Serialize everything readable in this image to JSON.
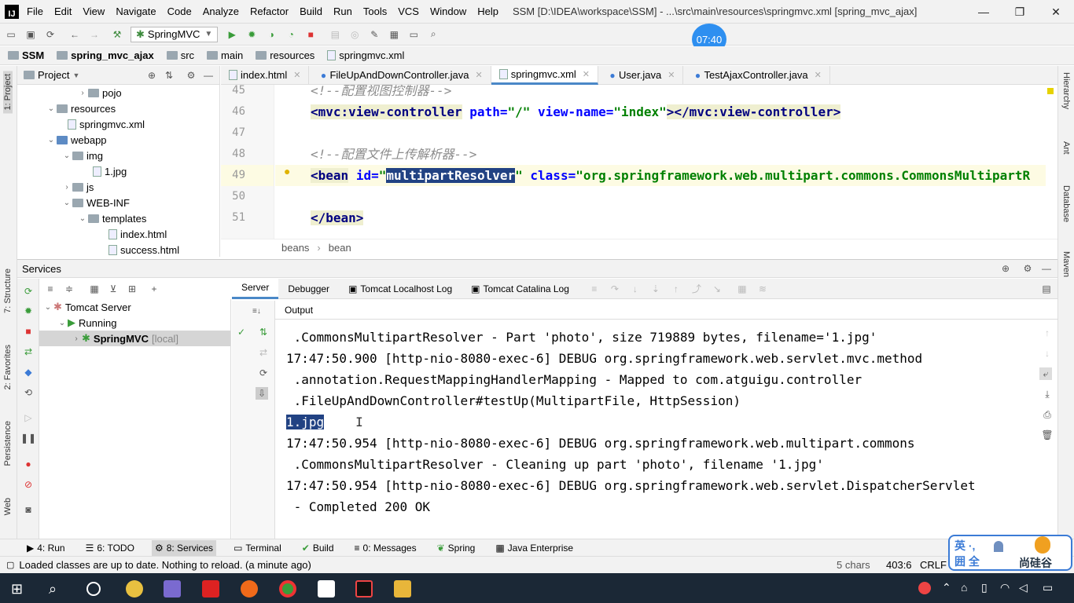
{
  "window": {
    "title": "SSM [D:\\IDEA\\workspace\\SSM] - ...\\src\\main\\resources\\springmvc.xml [spring_mvc_ajax]",
    "menu": [
      "File",
      "Edit",
      "View",
      "Navigate",
      "Code",
      "Analyze",
      "Refactor",
      "Build",
      "Run",
      "Tools",
      "VCS",
      "Window",
      "Help"
    ],
    "controls": {
      "min": "—",
      "max": "❐",
      "close": "✕"
    }
  },
  "toolbar": {
    "run_config": "SpringMVC",
    "clock": "07:40"
  },
  "breadcrumb": [
    "SSM",
    "spring_mvc_ajax",
    "src",
    "main",
    "resources",
    "springmvc.xml"
  ],
  "left_stripe": [
    "1: Project",
    "7: Structure",
    "2: Favorites",
    "Persistence",
    "Web"
  ],
  "right_stripe": [
    "Hierarchy",
    "Ant",
    "Database",
    "Maven"
  ],
  "project": {
    "header": "Project",
    "tree": [
      {
        "label": "pojo",
        "depth": 4,
        "arrow": "›",
        "kind": "folder"
      },
      {
        "label": "resources",
        "depth": 2,
        "arrow": "⌄",
        "kind": "folder"
      },
      {
        "label": "springmvc.xml",
        "depth": 3,
        "arrow": "",
        "kind": "file"
      },
      {
        "label": "webapp",
        "depth": 2,
        "arrow": "⌄",
        "kind": "folder"
      },
      {
        "label": "img",
        "depth": 3,
        "arrow": "⌄",
        "kind": "folder"
      },
      {
        "label": "1.jpg",
        "depth": 4,
        "arrow": "",
        "kind": "file"
      },
      {
        "label": "js",
        "depth": 3,
        "arrow": "›",
        "kind": "folder"
      },
      {
        "label": "WEB-INF",
        "depth": 3,
        "arrow": "⌄",
        "kind": "folder"
      },
      {
        "label": "templates",
        "depth": 4,
        "arrow": "⌄",
        "kind": "folder"
      },
      {
        "label": "index.html",
        "depth": 5,
        "arrow": "",
        "kind": "file"
      },
      {
        "label": "success.html",
        "depth": 5,
        "arrow": "",
        "kind": "file"
      }
    ]
  },
  "editor": {
    "tabs": [
      "index.html",
      "FileUpAndDownController.java",
      "springmvc.xml",
      "User.java",
      "TestAjaxController.java"
    ],
    "active_tab": 2,
    "line_numbers": [
      "45",
      "46",
      "47",
      "48",
      "49",
      "50",
      "51"
    ],
    "lines": {
      "l45": "<!--配置视图控制器-->",
      "l46_tag_open": "<mvc:view-controller",
      "l46_a1": "path=",
      "l46_v1": "\"/\"",
      "l46_a2": "view-name=",
      "l46_v2": "\"index\"",
      "l46_tag_close": "></mvc:view-controller>",
      "l48": "<!--配置文件上传解析器-->",
      "l49_tag": "<bean",
      "l49_a1": "id=",
      "l49_q1": "\"",
      "l49_sel": "multipartResolver",
      "l49_q2": "\"",
      "l49_a2": "class=",
      "l49_v2": "\"org.springframework.web.multipart.commons.CommonsMultipartR",
      "l51": "</bean>"
    },
    "crumbs": [
      "beans",
      "bean"
    ]
  },
  "services": {
    "header": "Services",
    "tree": [
      {
        "label": "Tomcat Server",
        "depth": 0
      },
      {
        "label": "Running",
        "depth": 1
      },
      {
        "label": "SpringMVC",
        "suffix": "[local]",
        "depth": 2
      }
    ],
    "tabs": [
      "Server",
      "Debugger",
      "Tomcat Localhost Log",
      "Tomcat Catalina Log"
    ],
    "output_label": "Output",
    "console": [
      " .CommonsMultipartResolver - Part 'photo', size 719889 bytes, filename='1.jpg'",
      "17:47:50.900 [http-nio-8080-exec-6] DEBUG org.springframework.web.servlet.mvc.method",
      " .annotation.RequestMappingHandlerMapping - Mapped to com.atguigu.controller",
      " .FileUpAndDownController#testUp(MultipartFile, HttpSession)",
      "1.jpg",
      "17:47:50.954 [http-nio-8080-exec-6] DEBUG org.springframework.web.multipart.commons",
      " .CommonsMultipartResolver - Cleaning up part 'photo', filename '1.jpg'",
      "17:47:50.954 [http-nio-8080-exec-6] DEBUG org.springframework.web.servlet.DispatcherServlet",
      " - Completed 200 OK"
    ]
  },
  "bottom_tools": [
    "4: Run",
    "6: TODO",
    "8: Services",
    "Terminal",
    "Build",
    "0: Messages",
    "Spring",
    "Java Enterprise"
  ],
  "status": {
    "message": "Loaded classes are up to date. Nothing to reload. (a minute ago)",
    "chars": "5 chars",
    "pos": "403:6",
    "eol": "CRLF"
  },
  "ime": {
    "top": "英 ·,",
    "bottom": "囲 全",
    "brand": "尚硅谷"
  },
  "taskbar": {
    "time": ""
  }
}
